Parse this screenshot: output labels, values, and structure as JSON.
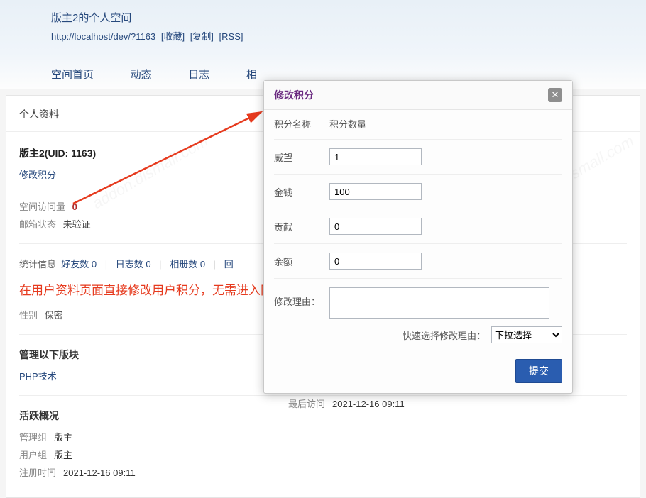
{
  "header": {
    "title": "版主2的个人空间",
    "url": "http://localhost/dev/?1163",
    "actions": {
      "fav": "[收藏]",
      "copy": "[复制]",
      "rss": "[RSS]"
    }
  },
  "nav": [
    "空间首页",
    "动态",
    "日志",
    "相"
  ],
  "profile": {
    "section_title": "个人资料",
    "uid_line": "版主2(UID: 1163)",
    "edit_label": "修改积分",
    "visits_label": "空间访问量",
    "visits_value": "0",
    "email_label": "邮箱状态",
    "email_value": "未验证",
    "stats_prefix": "统计信息",
    "stats": [
      {
        "label": "好友数",
        "value": "0"
      },
      {
        "label": "日志数",
        "value": "0"
      },
      {
        "label": "相册数",
        "value": "0"
      },
      {
        "label": "回",
        "value": ""
      }
    ],
    "annotation": "在用户资料页面直接修改用户积分，无需进入网站后台",
    "gender_label": "性别",
    "gender_value": "保密",
    "manage_title": "管理以下版块",
    "forum": "PHP技术",
    "activity_title": "活跃概况",
    "admin_group_label": "管理组",
    "admin_group_value": "版主",
    "user_group_label": "用户组",
    "user_group_value": "版主",
    "regtime_label": "注册时间",
    "regtime_value": "2021-12-16 09:11",
    "lastvisit_label": "最后访问",
    "lastvisit_value": "2021-12-16 09:11"
  },
  "modal": {
    "title": "修改积分",
    "col_name": "积分名称",
    "col_qty": "积分数量",
    "rows": [
      {
        "label": "威望",
        "value": "1"
      },
      {
        "label": "金钱",
        "value": "100"
      },
      {
        "label": "贡献",
        "value": "0"
      },
      {
        "label": "余额",
        "value": "0"
      }
    ],
    "reason_label": "修改理由：",
    "quick_label": "快速选择修改理由：",
    "quick_placeholder": "下拉选择",
    "submit": "提交"
  }
}
